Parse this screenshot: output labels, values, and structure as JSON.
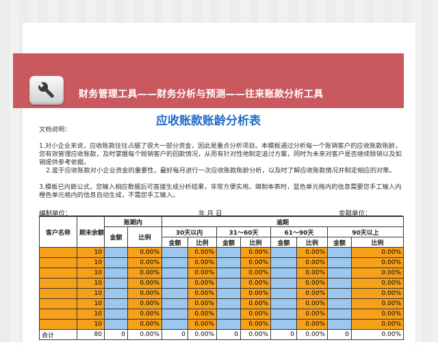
{
  "banner": {
    "title": "财务管理工具——财务分析与预测——往来账款分析工具",
    "icon": "wrench-icon"
  },
  "report": {
    "title": "应收账款账龄分析表"
  },
  "notes": {
    "heading": "文档说明：",
    "p1_line1": "1.对小企业来说，应收账款往往占据了很大一部分资金，因此是重点分析项目。本模板通过分析每一个账销客户的应收账款账龄，帮助",
    "p1_line2": "您有效管理应收账款，及时掌握每个赊销客户的回款情况，从而有针对性地制定追讨方案，同时为未来对客户是否继续赊销以及如何赊",
    "p1_line3": "销提供参考依据。",
    "p2": "2.鉴于应收账款对小企业资金的重要性，最好每月进行一次应收账款账龄分析，以及时了解应收账款情况并制定相应的对策。",
    "p3_line1": "3.模板已内嵌公式，您输入相应数据后可直接生成分析结果，非常方便实用。填制本表时，蓝色单元格内的信息需要您手工输入内容；",
    "p3_line2": "橙色单元格内的信息自动生成，不需您手工输入。"
  },
  "meta": {
    "unit_left": "编制单位：",
    "date": "年    月    日",
    "unit_right": "金额单位："
  },
  "table": {
    "h_customer": "客户名称",
    "h_balance": "期末余额",
    "h_in_period": "账期内",
    "h_overdue": "逾期",
    "h_30": "30天以内",
    "h_31_60": "31～60天",
    "h_61_90": "61～90天",
    "h_90": "90天以上",
    "h_amount": "金额",
    "h_ratio": "比例",
    "rows": [
      {
        "balance": "10",
        "ratio": "0.00%"
      },
      {
        "balance": "10",
        "ratio": "0.00%"
      },
      {
        "balance": "10",
        "ratio": "0.00%"
      },
      {
        "balance": "10",
        "ratio": "0.00%"
      },
      {
        "balance": "10",
        "ratio": "0.00%"
      },
      {
        "balance": "10",
        "ratio": "0.00%"
      },
      {
        "balance": "10",
        "ratio": "0.00%"
      },
      {
        "balance": "10",
        "ratio": "0.00%"
      }
    ],
    "total": {
      "label": "合计",
      "balance": "80",
      "zero": "0",
      "ratio": "0.00%"
    }
  },
  "colors": {
    "banner": "#c9595f",
    "title": "#1f6bc7",
    "orange": "#f7a01a",
    "blue": "#9cc7ee"
  }
}
